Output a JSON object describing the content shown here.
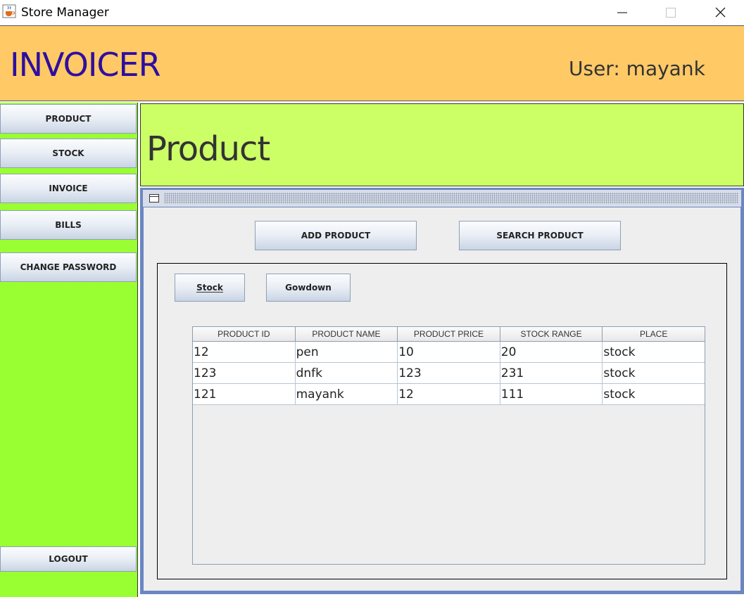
{
  "window": {
    "title": "Store Manager",
    "icon": "java-coffee-cup-icon"
  },
  "header": {
    "brand": "INVOICER",
    "user": "User: mayank",
    "colors": {
      "background": "#ffc966",
      "brand_text": "#2e0fa0"
    }
  },
  "sidebar": {
    "color": "#99ff33",
    "items": [
      {
        "label": "PRODUCT"
      },
      {
        "label": "STOCK"
      },
      {
        "label": "INVOICE"
      },
      {
        "label": "BILLS"
      },
      {
        "label": "CHANGE PASSWORD"
      }
    ],
    "logout": "LOGOUT"
  },
  "page": {
    "title": "Product",
    "title_bg": "#ccff66"
  },
  "frame": {
    "add_button": "ADD PRODUCT",
    "search_button": "SEARCH PRODUCT",
    "stock_button": "Stock",
    "gowdown_button": "Gowdown",
    "table": {
      "columns": [
        "PRODUCT ID",
        "PRODUCT NAME",
        "PRODUCT PRICE",
        "STOCK RANGE",
        "PLACE"
      ],
      "rows": [
        [
          "12",
          "pen",
          "10",
          "20",
          "stock"
        ],
        [
          "123",
          "dnfk",
          "123",
          "231",
          "stock"
        ],
        [
          "121",
          "mayank",
          "12",
          "111",
          "stock"
        ]
      ]
    }
  }
}
